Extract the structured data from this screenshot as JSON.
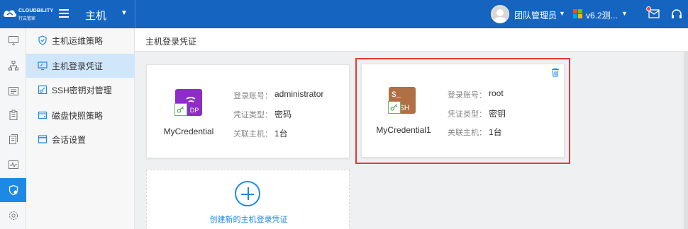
{
  "app": {
    "brand_name": "CLOUDBILITY",
    "brand_sub": "行云管家",
    "module": "主机"
  },
  "header": {
    "team_label": "团队管理员",
    "version_label": "v6.2测..."
  },
  "nav": {
    "items": [
      {
        "label": "主机运维策略"
      },
      {
        "label": "主机登录凭证"
      },
      {
        "label": "SSH密钥对管理"
      },
      {
        "label": "磁盘快照策略"
      },
      {
        "label": "会话设置"
      }
    ]
  },
  "breadcrumb": "主机登录凭证",
  "cards": [
    {
      "name": "MyCredential",
      "badge_text": "RDP",
      "badge_color": "#8e2dc5",
      "account_label": "登录账号：",
      "account_value": "administrator",
      "type_label": "凭证类型：",
      "type_value": "密码",
      "hosts_label": "关联主机：",
      "hosts_value": "1台"
    },
    {
      "name": "MyCredential1",
      "badge_text": "SSH",
      "badge_color": "#b07046",
      "account_label": "登录账号：",
      "account_value": "root",
      "type_label": "凭证类型：",
      "type_value": "密钥",
      "hosts_label": "关联主机：",
      "hosts_value": "1台"
    }
  ],
  "add_card_label": "创建新的主机登录凭证",
  "colors": {
    "topbar": "#1565c0",
    "accent": "#1e88e5",
    "nav_active": "#cfe6fb",
    "highlight": "#e53935"
  }
}
